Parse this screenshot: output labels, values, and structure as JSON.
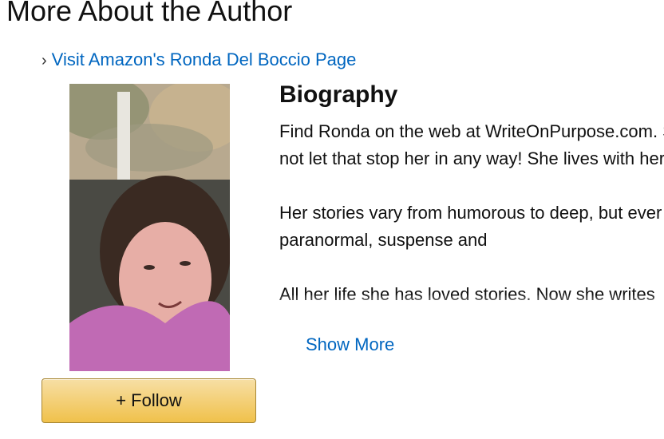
{
  "section_title": "More About the Author",
  "visit_link": {
    "chevron": "›",
    "label": "Visit Amazon's Ronda Del Boccio Page"
  },
  "author_photo": {
    "description_icon": "author-photo"
  },
  "follow_button": {
    "label": "+ Follow"
  },
  "biography": {
    "heading": "Biography",
    "paragraphs": [
      "Find Ronda on the web at WriteOnPurpose.com. She is blind, but she does not let that stop her in any way! She lives with her cat.",
      "Her stories vary from humorous to deep, but ever genres to write are paranormal, suspense and",
      "All her life she has loved stories. Now she writes"
    ],
    "show_more_label": "Show More"
  },
  "colors": {
    "link": "#0066c0",
    "button_top": "#f7dfa5",
    "button_bottom": "#f0c14b",
    "button_border": "#a88734"
  }
}
